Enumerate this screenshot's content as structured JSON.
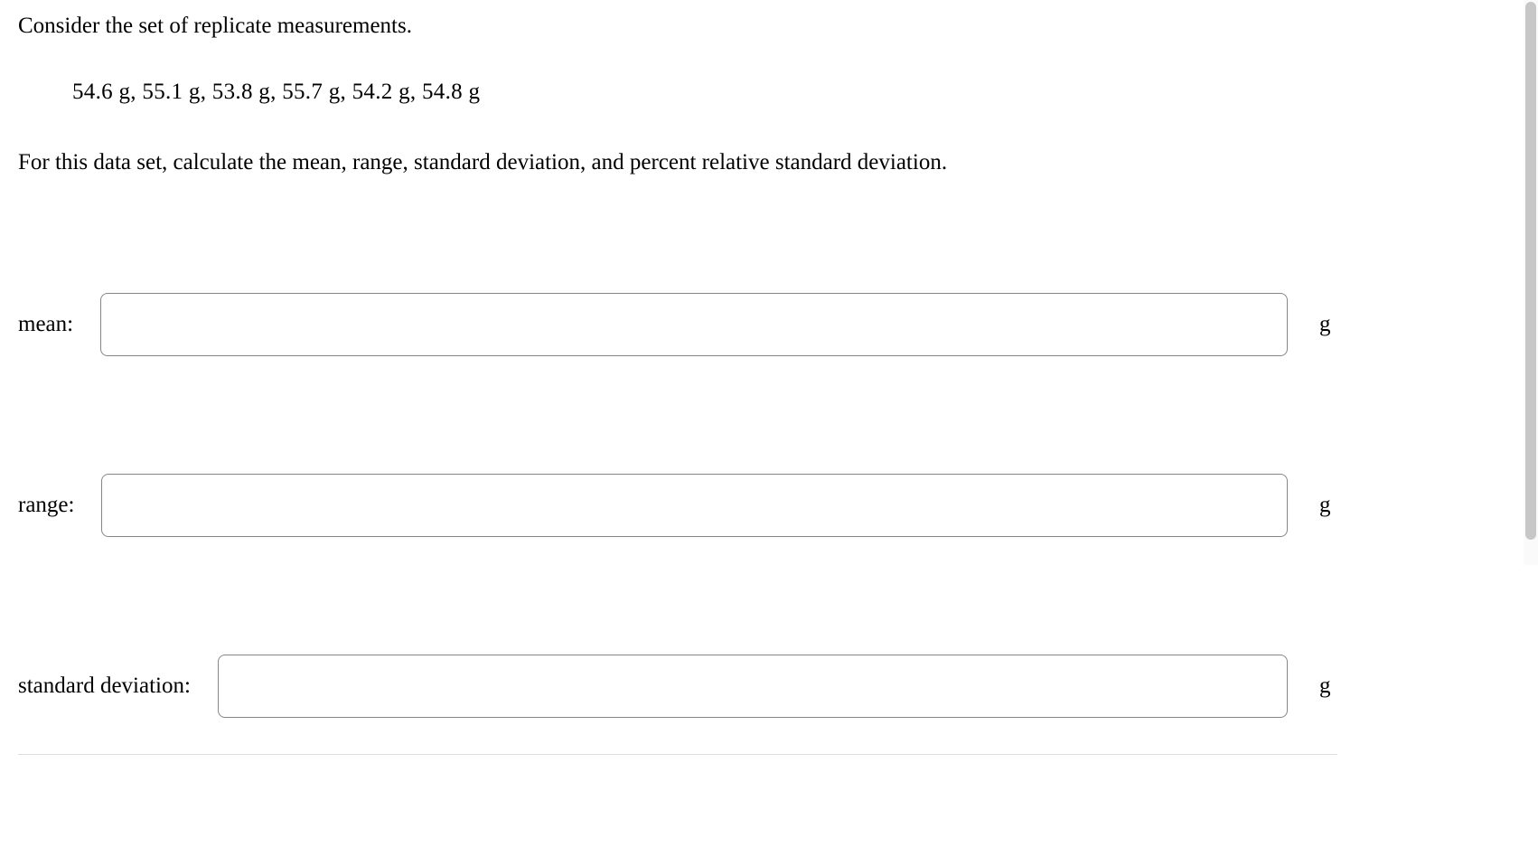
{
  "question": {
    "intro": "Consider the set of replicate measurements.",
    "data_set": "54.6 g, 55.1 g, 53.8 g, 55.7 g, 54.2 g, 54.8 g",
    "instruction": "For this data set, calculate the mean, range, standard deviation, and percent relative standard deviation."
  },
  "inputs": {
    "mean": {
      "label": "mean:",
      "value": "",
      "unit": "g"
    },
    "range": {
      "label": "range:",
      "value": "",
      "unit": "g"
    },
    "std_dev": {
      "label": "standard deviation:",
      "value": "",
      "unit": "g"
    }
  }
}
